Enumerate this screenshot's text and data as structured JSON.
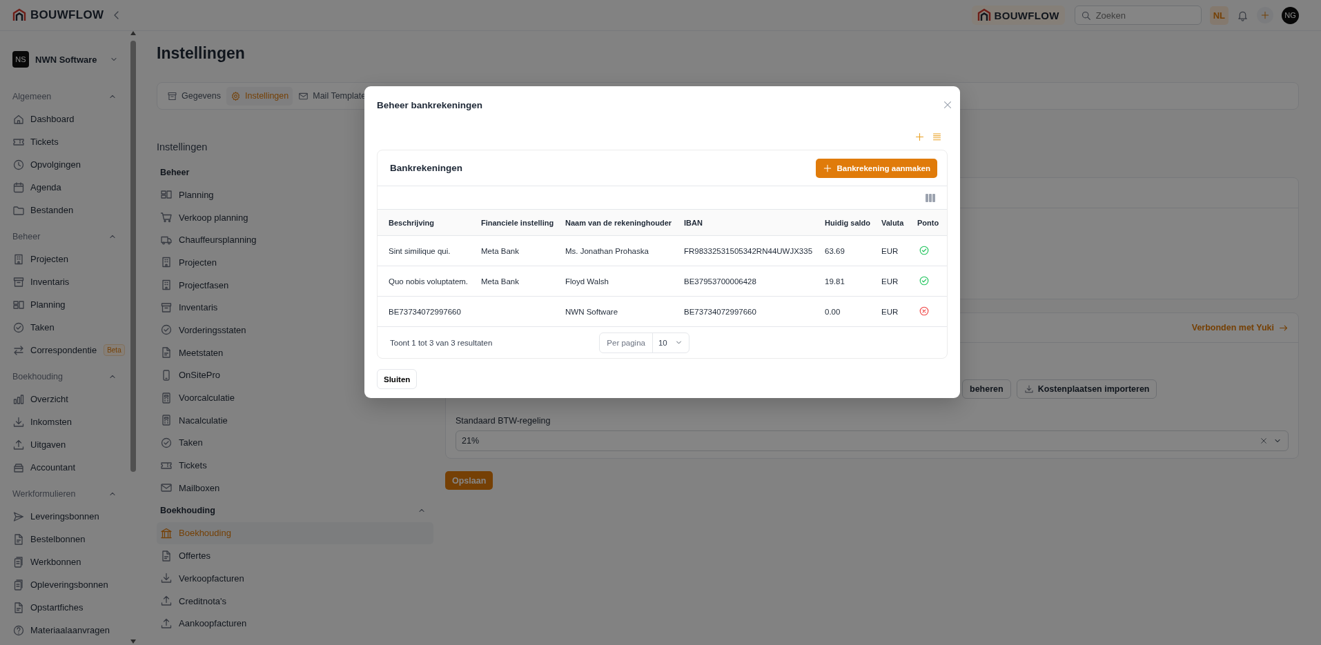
{
  "topbar": {
    "brand": "BOUWFLOW",
    "brand_chip": "BOUWFLOW",
    "search": {
      "placeholder": "Zoeken"
    },
    "language": "NL",
    "avatar": "NG"
  },
  "sidebar": {
    "org": {
      "initials": "NS",
      "name": "NWN Software"
    },
    "sections": [
      {
        "title": "Algemeen",
        "expanded": true,
        "items": [
          {
            "label": "Dashboard"
          },
          {
            "label": "Tickets"
          },
          {
            "label": "Opvolgingen"
          },
          {
            "label": "Agenda"
          },
          {
            "label": "Bestanden"
          }
        ]
      },
      {
        "title": "Beheer",
        "expanded": true,
        "items": [
          {
            "label": "Projecten"
          },
          {
            "label": "Inventaris"
          },
          {
            "label": "Planning"
          },
          {
            "label": "Taken"
          },
          {
            "label": "Correspondentie",
            "badge": "Beta"
          }
        ]
      },
      {
        "title": "Boekhouding",
        "expanded": true,
        "items": [
          {
            "label": "Overzicht"
          },
          {
            "label": "Inkomsten"
          },
          {
            "label": "Uitgaven"
          },
          {
            "label": "Accountant"
          }
        ]
      },
      {
        "title": "Werkformulieren",
        "expanded": true,
        "items": [
          {
            "label": "Leveringsbonnen"
          },
          {
            "label": "Bestelbonnen"
          },
          {
            "label": "Werkbonnen"
          },
          {
            "label": "Opleveringsbonnen"
          },
          {
            "label": "Opstartfiches"
          },
          {
            "label": "Materiaalaanvragen"
          }
        ]
      }
    ]
  },
  "page": {
    "title": "Instellingen",
    "tabs": [
      {
        "label": "Gegevens",
        "selected": false
      },
      {
        "label": "Instellingen",
        "selected": true
      },
      {
        "label": "Mail Template",
        "selected": false
      }
    ]
  },
  "settings_nav": {
    "title": "Instellingen",
    "groups": [
      {
        "title": "Beheer",
        "items": [
          {
            "label": "Planning",
            "selected": false
          },
          {
            "label": "Verkoop planning",
            "selected": false
          },
          {
            "label": "Chauffeursplanning",
            "selected": false
          },
          {
            "label": "Projecten",
            "selected": false
          },
          {
            "label": "Projectfasen",
            "selected": false
          },
          {
            "label": "Inventaris",
            "selected": false
          },
          {
            "label": "Vorderingsstaten",
            "selected": false
          },
          {
            "label": "Meetstaten",
            "selected": false
          },
          {
            "label": "OnSitePro",
            "selected": false
          },
          {
            "label": "Voorcalculatie",
            "selected": false
          },
          {
            "label": "Nacalculatie",
            "selected": false
          },
          {
            "label": "Taken",
            "selected": false
          },
          {
            "label": "Tickets",
            "selected": false
          },
          {
            "label": "Mailboxen",
            "selected": false
          }
        ]
      },
      {
        "title": "Boekhouding",
        "expanded": true,
        "items": [
          {
            "label": "Boekhouding",
            "selected": true
          },
          {
            "label": "Offertes",
            "selected": false
          },
          {
            "label": "Verkoopfacturen",
            "selected": false
          },
          {
            "label": "Creditnota's",
            "selected": false
          },
          {
            "label": "Aankoopfacturen",
            "selected": false
          }
        ]
      }
    ]
  },
  "accounting_card": {
    "link": "Verbonden met Yuki",
    "buttons": [
      "beheren",
      "Kostenplaatsen importeren"
    ],
    "vat": {
      "label": "Standaard BTW-regeling",
      "value": "21%"
    }
  },
  "save_button": "Opslaan",
  "modal": {
    "title": "Beheer bankrekeningen",
    "card": {
      "title": "Bankrekeningen",
      "create_button": "Bankrekening aanmaken",
      "columns": [
        "Beschrijving",
        "Financiele instelling",
        "Naam van de rekeninghouder",
        "IBAN",
        "Huidig saldo",
        "Valuta",
        "Ponto"
      ],
      "rows": [
        {
          "description": "Sint similique qui.",
          "institution": "Meta Bank",
          "holder": "Ms. Jonathan Prohaska",
          "iban": "FR98332531505342RN44UWJX335",
          "balance": "63.69",
          "currency": "EUR",
          "ponto": true
        },
        {
          "description": "Quo nobis voluptatem.",
          "institution": "Meta Bank",
          "holder": "Floyd Walsh",
          "iban": "BE37953700006428",
          "balance": "19.81",
          "currency": "EUR",
          "ponto": true
        },
        {
          "description": "BE73734072997660",
          "holder": "NWN Software",
          "iban": "BE73734072997660",
          "balance": "0.00",
          "currency": "EUR",
          "ponto": false
        }
      ],
      "summary": "Toont 1 tot 3 van 3 resultaten",
      "per_page": {
        "label": "Per pagina",
        "value": "10"
      }
    },
    "close_button": "Sluiten"
  }
}
